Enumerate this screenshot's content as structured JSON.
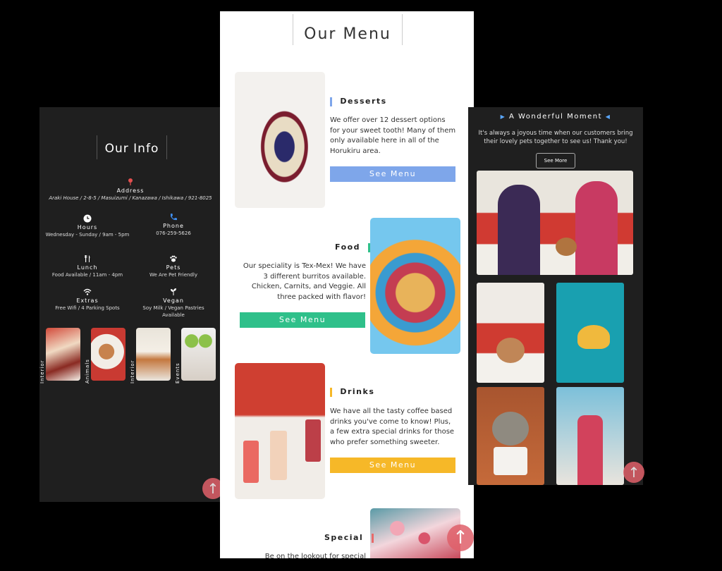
{
  "info": {
    "title": "Our Info",
    "address_label": "Address",
    "address_value": "Araki House / 2-8-5 / Masuizumi / Kanazawa / Ishikawa / 921-8025",
    "items": [
      {
        "label": "Hours",
        "value": "Wednesday - Sunday / 9am - 5pm"
      },
      {
        "label": "Phone",
        "value": "076-259-5626"
      },
      {
        "label": "Lunch",
        "value": "Food Available / 11am - 4pm"
      },
      {
        "label": "Pets",
        "value": "We Are Pet Friendly"
      },
      {
        "label": "Extras",
        "value": "Free Wifi / 4 Parking Spots"
      },
      {
        "label": "Vegan",
        "value": "Soy Milk / Vegan Pastries Available"
      }
    ],
    "gallery": [
      "Interior",
      "Animals",
      "Interior",
      "Events"
    ]
  },
  "menu": {
    "title": "Our Menu",
    "sections": [
      {
        "heading": "Desserts",
        "text": "We offer over 12 dessert options for your sweet tooth! Many of them only available here in all of the Horukiru area.",
        "button": "See Menu",
        "color": "#7ea6ea"
      },
      {
        "heading": "Food",
        "text": "Our speciality is Tex-Mex! We have 3 different burritos available. Chicken, Carnits, and Veggie. All three packed with flavor!",
        "button": "See Menu",
        "color": "#2fc08a"
      },
      {
        "heading": "Drinks",
        "text": "We have all the tasty coffee based drinks you've come to know! Plus, a few extra special drinks for those who prefer something sweeter.",
        "button": "See Menu",
        "color": "#f6b828"
      },
      {
        "heading": "Special",
        "text": "Be on the lookout for special",
        "color": "#e86a6a"
      }
    ]
  },
  "moment": {
    "title": "A Wonderful Moment",
    "text": "It's always a joyous time when our customers bring their lovely pets together to see us! Thank you!",
    "button": "See More"
  },
  "colors": {
    "panel_dark": "#1f1f1f",
    "accent_red": "#e0606a",
    "accent_blue": "#5aa7ff"
  }
}
